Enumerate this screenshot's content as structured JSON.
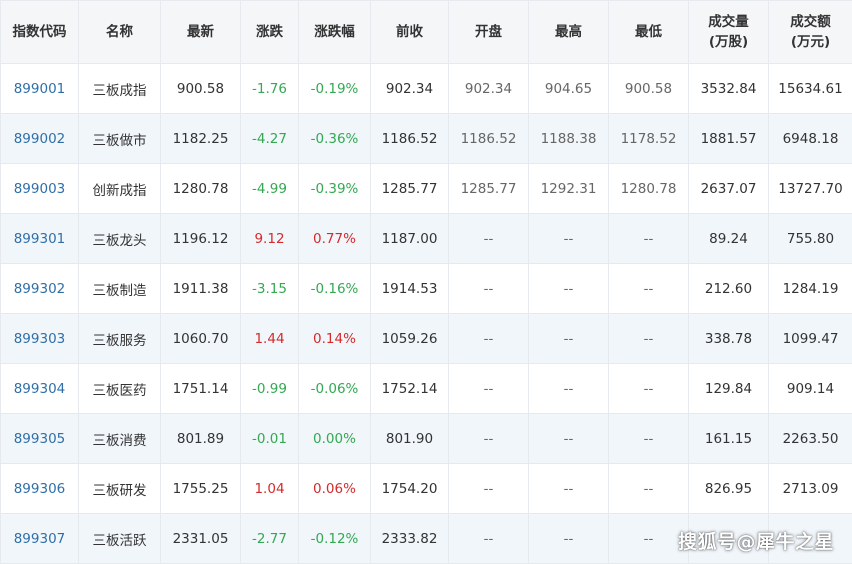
{
  "table": {
    "headers": [
      {
        "line1": "指数代码",
        "line2": ""
      },
      {
        "line1": "名称",
        "line2": ""
      },
      {
        "line1": "最新",
        "line2": ""
      },
      {
        "line1": "涨跌",
        "line2": ""
      },
      {
        "line1": "涨跌幅",
        "line2": ""
      },
      {
        "line1": "前收",
        "line2": ""
      },
      {
        "line1": "开盘",
        "line2": ""
      },
      {
        "line1": "最高",
        "line2": ""
      },
      {
        "line1": "最低",
        "line2": ""
      },
      {
        "line1": "成交量",
        "line2": "(万股)"
      },
      {
        "line1": "成交额",
        "line2": "(万元)"
      }
    ],
    "rows": [
      {
        "code": "899001",
        "name": "三板成指",
        "latest": "900.58",
        "change": "-1.76",
        "pct": "-0.19%",
        "prev": "902.34",
        "open": "902.34",
        "high": "904.65",
        "low": "900.58",
        "volume": "3532.84",
        "amount": "15634.61",
        "trend": "down"
      },
      {
        "code": "899002",
        "name": "三板做市",
        "latest": "1182.25",
        "change": "-4.27",
        "pct": "-0.36%",
        "prev": "1186.52",
        "open": "1186.52",
        "high": "1188.38",
        "low": "1178.52",
        "volume": "1881.57",
        "amount": "6948.18",
        "trend": "down"
      },
      {
        "code": "899003",
        "name": "创新成指",
        "latest": "1280.78",
        "change": "-4.99",
        "pct": "-0.39%",
        "prev": "1285.77",
        "open": "1285.77",
        "high": "1292.31",
        "low": "1280.78",
        "volume": "2637.07",
        "amount": "13727.70",
        "trend": "down"
      },
      {
        "code": "899301",
        "name": "三板龙头",
        "latest": "1196.12",
        "change": "9.12",
        "pct": "0.77%",
        "prev": "1187.00",
        "open": "--",
        "high": "--",
        "low": "--",
        "volume": "89.24",
        "amount": "755.80",
        "trend": "up"
      },
      {
        "code": "899302",
        "name": "三板制造",
        "latest": "1911.38",
        "change": "-3.15",
        "pct": "-0.16%",
        "prev": "1914.53",
        "open": "--",
        "high": "--",
        "low": "--",
        "volume": "212.60",
        "amount": "1284.19",
        "trend": "down"
      },
      {
        "code": "899303",
        "name": "三板服务",
        "latest": "1060.70",
        "change": "1.44",
        "pct": "0.14%",
        "prev": "1059.26",
        "open": "--",
        "high": "--",
        "low": "--",
        "volume": "338.78",
        "amount": "1099.47",
        "trend": "up"
      },
      {
        "code": "899304",
        "name": "三板医药",
        "latest": "1751.14",
        "change": "-0.99",
        "pct": "-0.06%",
        "prev": "1752.14",
        "open": "--",
        "high": "--",
        "low": "--",
        "volume": "129.84",
        "amount": "909.14",
        "trend": "down"
      },
      {
        "code": "899305",
        "name": "三板消费",
        "latest": "801.89",
        "change": "-0.01",
        "pct": "0.00%",
        "prev": "801.90",
        "open": "--",
        "high": "--",
        "low": "--",
        "volume": "161.15",
        "amount": "2263.50",
        "trend": "down"
      },
      {
        "code": "899306",
        "name": "三板研发",
        "latest": "1755.25",
        "change": "1.04",
        "pct": "0.06%",
        "prev": "1754.20",
        "open": "--",
        "high": "--",
        "low": "--",
        "volume": "826.95",
        "amount": "2713.09",
        "trend": "up"
      },
      {
        "code": "899307",
        "name": "三板活跃",
        "latest": "2331.05",
        "change": "-2.77",
        "pct": "-0.12%",
        "prev": "2333.82",
        "open": "--",
        "high": "--",
        "low": "--",
        "volume": "",
        "amount": "",
        "trend": "down"
      }
    ]
  },
  "colors": {
    "up": "#d62b2b",
    "down": "#34a853",
    "code_link": "#2f6fa8",
    "header_bg": "#f4f6f8",
    "stripe_bg": "#f1f6fb"
  },
  "watermark": {
    "text": "搜狐号@犀牛之星"
  }
}
